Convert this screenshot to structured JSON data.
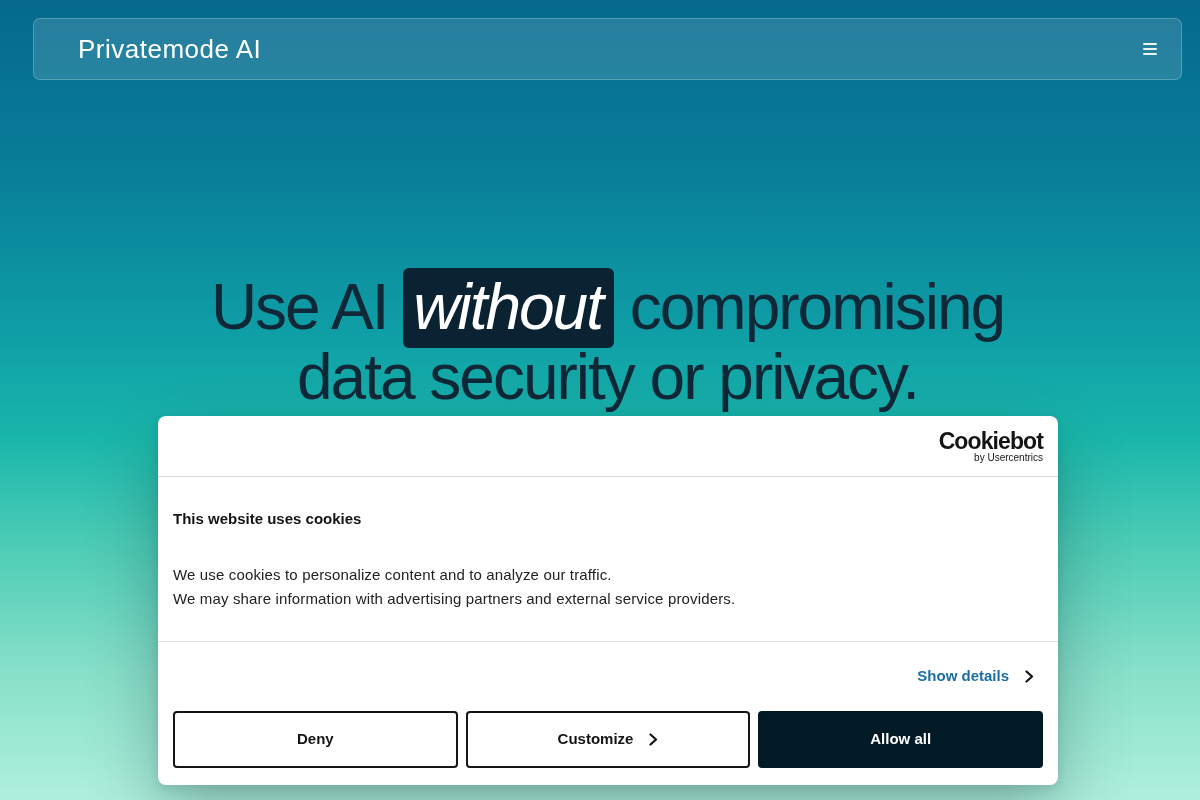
{
  "navbar": {
    "logo": "Privatemode AI"
  },
  "hero": {
    "headline": "Use AI *without* compromising data security or privacy."
  },
  "cookie_dialog": {
    "brand": {
      "name": "Cookiebot",
      "tagline": "by Usercentrics"
    },
    "title": "This website uses cookies",
    "body": [
      "We use cookies to personalize content and to analyze our traffic.",
      "We may share information with advertising partners and external service providers."
    ],
    "details_link": "Show details",
    "buttons": [
      {
        "label": "Deny",
        "kind": "outline"
      },
      {
        "label": "Customize",
        "kind": "submenu"
      },
      {
        "label": "Allow all",
        "kind": "filled"
      }
    ]
  }
}
